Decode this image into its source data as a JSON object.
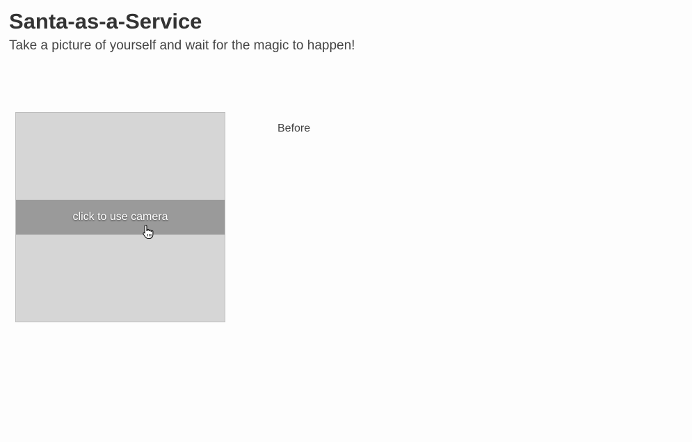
{
  "header": {
    "title": "Santa-as-a-Service",
    "subtitle": "Take a picture of yourself and wait for the magic to happen!"
  },
  "camera": {
    "button_label": "click to use camera",
    "icon": "hand-pointer-icon"
  },
  "result": {
    "before_label": "Before"
  },
  "colors": {
    "background": "#fdfdfd",
    "camera_box": "#d6d6d6",
    "camera_bar": "#9a9a9a",
    "text": "#333333"
  }
}
